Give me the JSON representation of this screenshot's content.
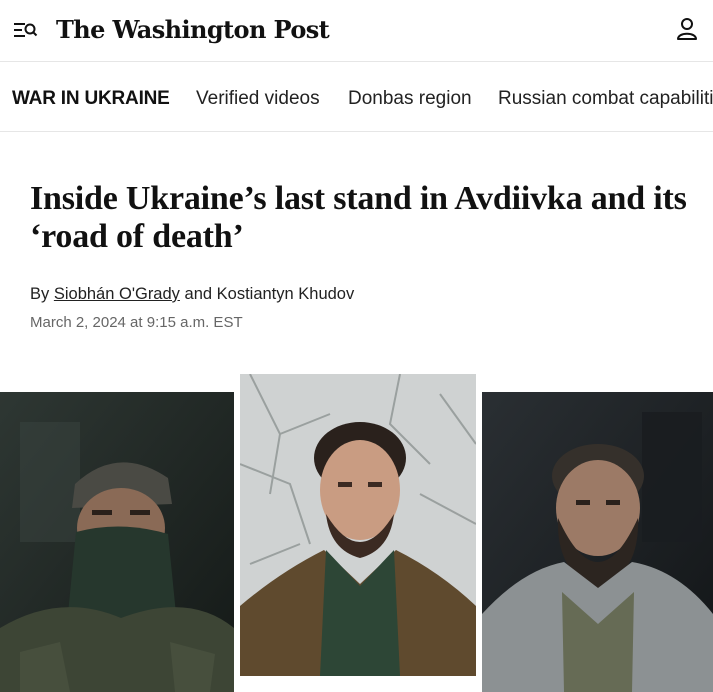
{
  "header": {
    "menu_icon": "menu-search-icon",
    "logo_text": "The Washington Post",
    "account_icon": "user-icon"
  },
  "section_nav": {
    "title": "WAR IN UKRAINE",
    "links": [
      {
        "label": "Verified videos"
      },
      {
        "label": "Donbas region"
      },
      {
        "label": "Russian combat capabiliti"
      }
    ]
  },
  "article": {
    "headline": "Inside Ukraine’s last stand in Avdiivka and its ‘road of death’",
    "byline_prefix": "By",
    "author_1": "Siobhán O'Grady",
    "byline_joiner": "and",
    "author_2": "Kostiantyn Khudov",
    "timestamp": "March 2, 2024 at 9:15 a.m. EST"
  },
  "photos": [
    {
      "id": "soldier-masked",
      "background": "#1f2622"
    },
    {
      "id": "soldier-young",
      "background": "#cfd2d2"
    },
    {
      "id": "soldier-bearded",
      "background": "#1b1f22"
    }
  ]
}
